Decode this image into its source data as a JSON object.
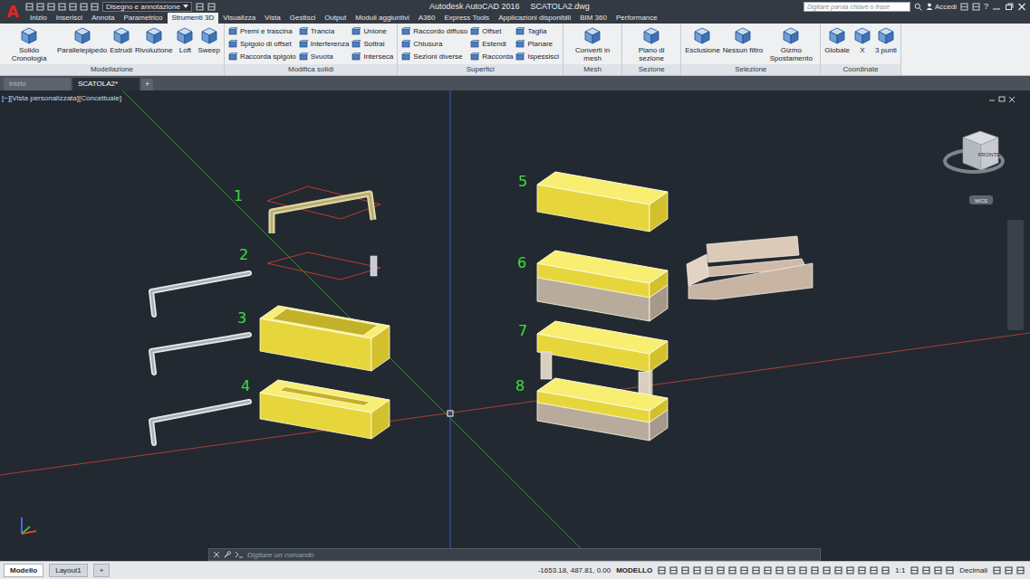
{
  "app": {
    "logo": "A",
    "title": "Autodesk AutoCAD 2016",
    "file": "SCATOLA2.dwg"
  },
  "workspace": {
    "value": "Disegno e annotazione"
  },
  "search": {
    "placeholder": "Digitare parola chiave o frase"
  },
  "account": {
    "label": "Accedi"
  },
  "help": {
    "label": "?"
  },
  "ribbon_tabs": [
    {
      "label": "Inizio",
      "selected": false
    },
    {
      "label": "Inserisci",
      "selected": false
    },
    {
      "label": "Annota",
      "selected": false
    },
    {
      "label": "Parametrico",
      "selected": false
    },
    {
      "label": "Strumenti 3D",
      "selected": true
    },
    {
      "label": "Visualizza",
      "selected": false
    },
    {
      "label": "Vista",
      "selected": false
    },
    {
      "label": "Gestisci",
      "selected": false
    },
    {
      "label": "Output",
      "selected": false
    },
    {
      "label": "Moduli aggiuntivi",
      "selected": false
    },
    {
      "label": "A360",
      "selected": false
    },
    {
      "label": "Express Tools",
      "selected": false
    },
    {
      "label": "Applicazioni disponibili",
      "selected": false
    },
    {
      "label": "BIM 360",
      "selected": false
    },
    {
      "label": "Performance",
      "selected": false
    }
  ],
  "ribbon_groups": [
    {
      "title": "Modellazione",
      "columns": [
        {
          "kind": "large",
          "tools": [
            "Solido Cronologia"
          ]
        },
        {
          "kind": "large",
          "tools": [
            "Parallelepipedo"
          ]
        },
        {
          "kind": "large",
          "tools": [
            "Estrudi"
          ]
        },
        {
          "kind": "large",
          "tools": [
            "Rivoluzione"
          ]
        },
        {
          "kind": "large",
          "tools": [
            "Loft"
          ]
        },
        {
          "kind": "large",
          "tools": [
            "Sweep"
          ]
        }
      ]
    },
    {
      "title": "Modifica solidi",
      "columns": [
        {
          "kind": "small",
          "tools": [
            "Premi e trascina",
            "Spigolo di offset",
            "Raccorda spigolo"
          ]
        },
        {
          "kind": "small",
          "tools": [
            "Trancia",
            "Interferenza",
            "Svuota"
          ]
        },
        {
          "kind": "small",
          "tools": [
            "Unione",
            "Sottrai",
            "Interseca"
          ]
        }
      ]
    },
    {
      "title": "Superfici",
      "columns": [
        {
          "kind": "small",
          "tools": [
            "Raccordo diffuso",
            "Chiusura",
            "Sezioni diverse"
          ]
        },
        {
          "kind": "small",
          "tools": [
            "Offset",
            "Estendi",
            "Raccorda"
          ]
        },
        {
          "kind": "small",
          "tools": [
            "Taglia",
            "Planare",
            "Ispessisci"
          ]
        }
      ]
    },
    {
      "title": "Mesh",
      "columns": [
        {
          "kind": "large",
          "tools": [
            "Converti in mesh"
          ]
        }
      ]
    },
    {
      "title": "Sezione",
      "columns": [
        {
          "kind": "large",
          "tools": [
            "Piano di sezione"
          ]
        }
      ]
    },
    {
      "title": "Selezione",
      "columns": [
        {
          "kind": "large",
          "tools": [
            "Esclusione"
          ]
        },
        {
          "kind": "large",
          "tools": [
            "Nessun filtro"
          ]
        },
        {
          "kind": "large",
          "tools": [
            "Gizmo Spostamento"
          ]
        }
      ]
    },
    {
      "title": "Coordinate",
      "columns": [
        {
          "kind": "large",
          "tools": [
            "Globale"
          ]
        },
        {
          "kind": "large",
          "tools": [
            "X"
          ]
        },
        {
          "kind": "large",
          "tools": [
            "3 punti"
          ]
        }
      ]
    }
  ],
  "file_tabs": [
    {
      "label": "Inizio",
      "selected": false
    },
    {
      "label": "SCATOLA2*",
      "selected": true
    }
  ],
  "new_tab": "+",
  "viewport": {
    "label": "[−][Vista personalizzata][Concettuale]",
    "view_cube": {
      "face": "FRONTE",
      "ucs": "WCS"
    },
    "objects": [
      {
        "number": "1"
      },
      {
        "number": "2"
      },
      {
        "number": "3"
      },
      {
        "number": "4"
      },
      {
        "number": "5"
      },
      {
        "number": "6"
      },
      {
        "number": "7"
      },
      {
        "number": "8"
      }
    ]
  },
  "command_line": {
    "placeholder": "Digitare un comando"
  },
  "layout_tabs": [
    {
      "label": "Modello",
      "selected": true
    },
    {
      "label": "Layout1",
      "selected": false
    }
  ],
  "add_layout": "+",
  "status_bar": {
    "coordinates": "-1653.18, 487.81, 0.00",
    "space": "MODELLO",
    "scale": "1:1",
    "units": "Decimali"
  }
}
